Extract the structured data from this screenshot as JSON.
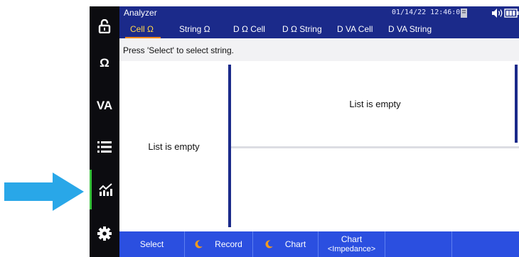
{
  "window": {
    "title": "Analyzer",
    "datetime": "01/14/22 12:46:03"
  },
  "sidebar": {
    "items": [
      {
        "name": "lock",
        "label": ""
      },
      {
        "name": "ohm",
        "label": "Ω"
      },
      {
        "name": "va",
        "label": "VA"
      },
      {
        "name": "list",
        "label": ""
      },
      {
        "name": "analyzer",
        "label": "",
        "active": true
      },
      {
        "name": "settings",
        "label": ""
      }
    ]
  },
  "tabs": [
    {
      "label": "Cell Ω",
      "active": true
    },
    {
      "label": "String Ω"
    },
    {
      "label": "D Ω Cell"
    },
    {
      "label": "D Ω String"
    },
    {
      "label": "D VA Cell"
    },
    {
      "label": "D VA String"
    }
  ],
  "hint": "Press 'Select' to select string.",
  "left_list": {
    "empty_text": "List is empty"
  },
  "right_list": {
    "empty_text": "List is empty"
  },
  "function_keys": [
    {
      "label": "Select"
    },
    {
      "label": "Record",
      "icon": "moon-icon"
    },
    {
      "label": "Chart",
      "icon": "moon-icon"
    },
    {
      "label": "Chart",
      "sub": "<Impedance>"
    },
    {
      "label": ""
    },
    {
      "label": ""
    }
  ],
  "colors": {
    "header": "#1b2a8a",
    "function_bar": "#2b4fe0",
    "active_tab": "#ffd54a",
    "tab_underline": "#f08a1c",
    "active_indicator": "#36c23a",
    "arrow": "#29a7e8"
  }
}
